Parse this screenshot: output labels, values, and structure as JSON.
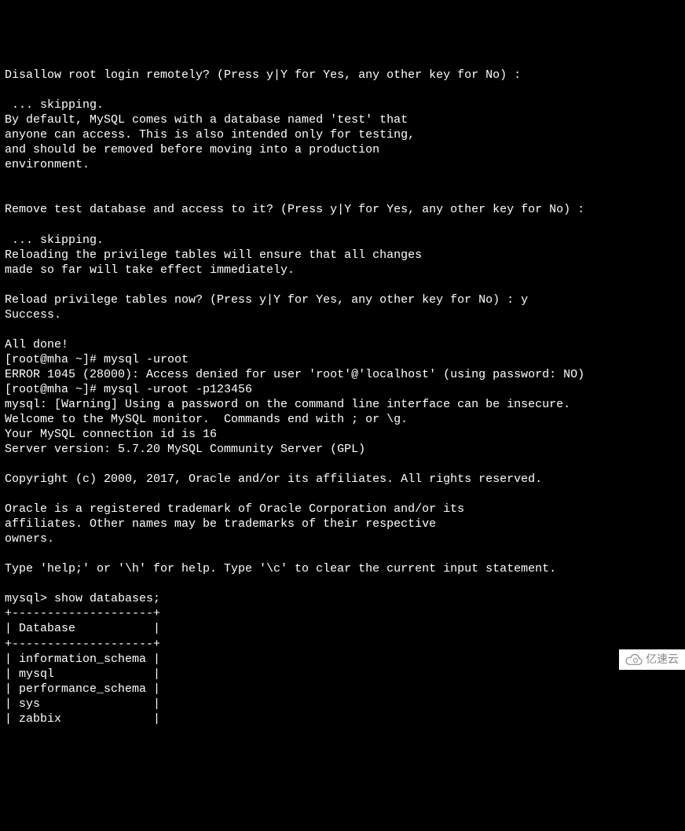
{
  "terminal": {
    "lines": [
      "Disallow root login remotely? (Press y|Y for Yes, any other key for No) :",
      "",
      " ... skipping.",
      "By default, MySQL comes with a database named 'test' that",
      "anyone can access. This is also intended only for testing,",
      "and should be removed before moving into a production",
      "environment.",
      "",
      "",
      "Remove test database and access to it? (Press y|Y for Yes, any other key for No) :",
      "",
      " ... skipping.",
      "Reloading the privilege tables will ensure that all changes",
      "made so far will take effect immediately.",
      "",
      "Reload privilege tables now? (Press y|Y for Yes, any other key for No) : y",
      "Success.",
      "",
      "All done!",
      "[root@mha ~]# mysql -uroot",
      "ERROR 1045 (28000): Access denied for user 'root'@'localhost' (using password: NO)",
      "[root@mha ~]# mysql -uroot -p123456",
      "mysql: [Warning] Using a password on the command line interface can be insecure.",
      "Welcome to the MySQL monitor.  Commands end with ; or \\g.",
      "Your MySQL connection id is 16",
      "Server version: 5.7.20 MySQL Community Server (GPL)",
      "",
      "Copyright (c) 2000, 2017, Oracle and/or its affiliates. All rights reserved.",
      "",
      "Oracle is a registered trademark of Oracle Corporation and/or its",
      "affiliates. Other names may be trademarks of their respective",
      "owners.",
      "",
      "Type 'help;' or '\\h' for help. Type '\\c' to clear the current input statement.",
      "",
      "mysql> show databases;",
      "+--------------------+",
      "| Database           |",
      "+--------------------+",
      "| information_schema |",
      "| mysql              |",
      "| performance_schema |",
      "| sys                |",
      "| zabbix             |"
    ]
  },
  "watermark": {
    "text": "亿速云"
  }
}
